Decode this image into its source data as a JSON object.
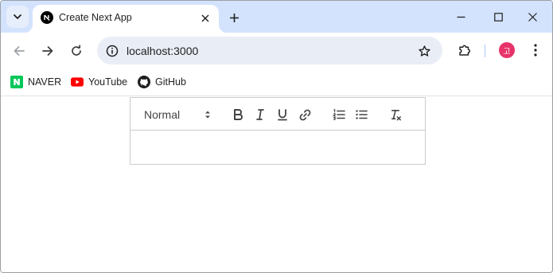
{
  "browser": {
    "tab": {
      "title": "Create Next App"
    },
    "address_bar": {
      "url": "localhost:3000"
    },
    "profile_initial": "고",
    "bookmarks": [
      {
        "label": "NAVER",
        "icon": "naver-icon"
      },
      {
        "label": "YouTube",
        "icon": "youtube-icon"
      },
      {
        "label": "GitHub",
        "icon": "github-icon"
      }
    ]
  },
  "editor": {
    "header_picker": {
      "value": "Normal"
    },
    "toolbar_buttons": [
      "bold",
      "italic",
      "underline",
      "link",
      "ordered-list",
      "bullet-list",
      "clean"
    ],
    "content": ""
  },
  "colors": {
    "tabstrip": "#d3e3fd",
    "omnibox": "#e9eef6",
    "avatar": "#e8336a",
    "naver": "#03c75a",
    "youtube": "#ff0000"
  }
}
